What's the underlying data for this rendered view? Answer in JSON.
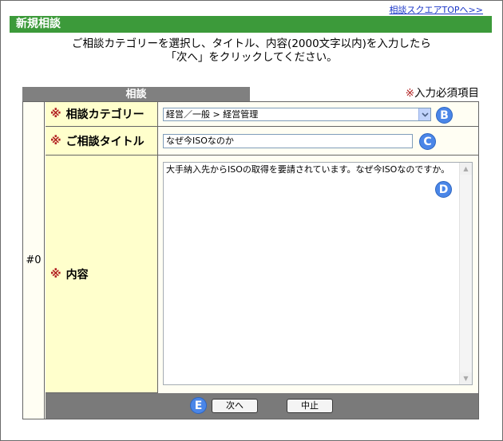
{
  "header": {
    "top_link": "相談スクエアTOPへ>>",
    "title": "新規相談"
  },
  "instructions": {
    "line1": "ご相談カテゴリーを選択し、タイトル、内容(2000文字以内)を入力したら",
    "line2": "「次へ」をクリックしてください。"
  },
  "tab": {
    "label": "相談"
  },
  "required_note": {
    "mark": "※",
    "text": "入力必須項目"
  },
  "form": {
    "index_label": "#0",
    "required_mark": "※",
    "category": {
      "label": "相談カテゴリー",
      "selected": "経営／一般 > 経営管理"
    },
    "title_field": {
      "label": "ご相談タイトル",
      "value": "なぜ今ISOなのか"
    },
    "content": {
      "label": "内容",
      "value": "大手納入先からISOの取得を要請されています。なぜ今ISOなのですか。"
    }
  },
  "badges": {
    "b": "B",
    "c": "C",
    "d": "D",
    "e": "E"
  },
  "buttons": {
    "next": "次へ",
    "cancel": "中止"
  },
  "colors": {
    "title_bar": "#3c9a3a",
    "badge": "#4a86e8",
    "required_mark": "#b22222",
    "link": "#1a36c8"
  }
}
